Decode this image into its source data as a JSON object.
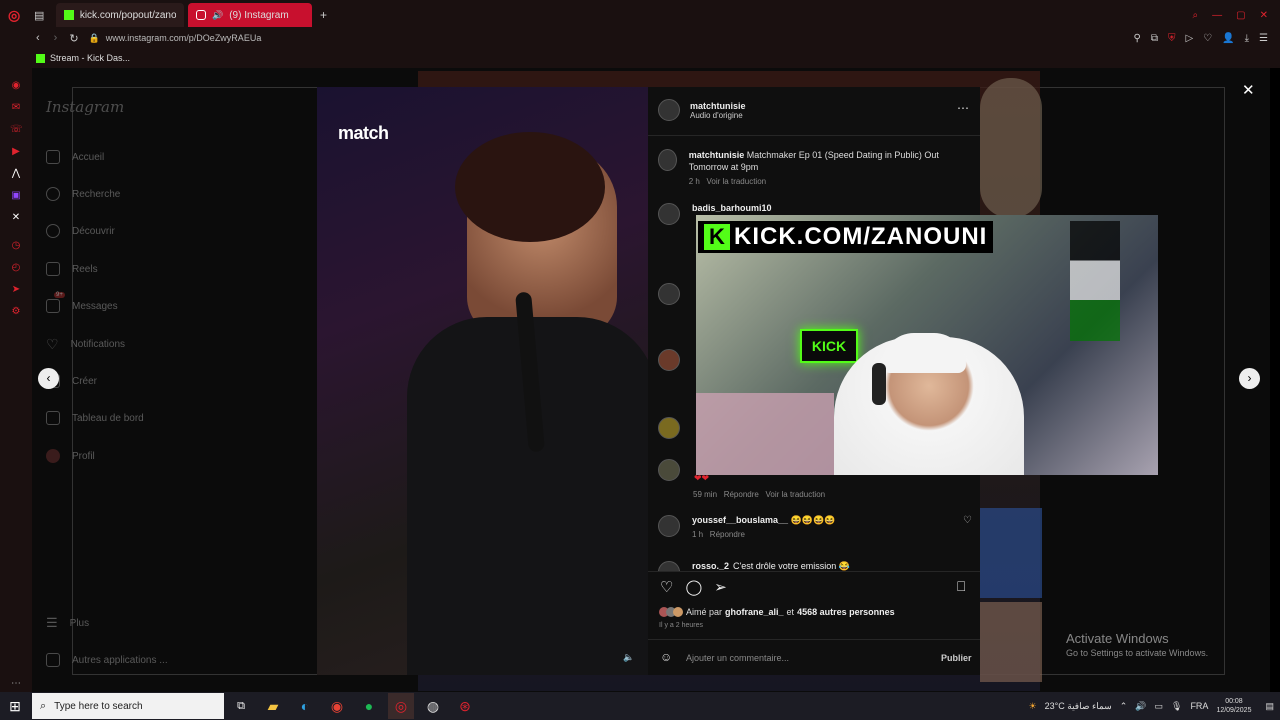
{
  "browser": {
    "tabs": [
      {
        "label": "kick.com/popout/zanouni",
        "favicon": "kick-icon",
        "active": false
      },
      {
        "label": "(9) Instagram",
        "favicon": "instagram-icon",
        "active": true
      }
    ],
    "url": "www.instagram.com/p/DOeZwyRAEUa",
    "bookmark": "Stream - Kick Das..."
  },
  "instagram": {
    "logo": "Instagram",
    "nav": [
      {
        "label": "Accueil",
        "icon": "home-icon"
      },
      {
        "label": "Recherche",
        "icon": "search-icon"
      },
      {
        "label": "Découvrir",
        "icon": "compass-icon"
      },
      {
        "label": "Reels",
        "icon": "reels-icon"
      },
      {
        "label": "Messages",
        "icon": "messages-icon",
        "badge": "9+"
      },
      {
        "label": "Notifications",
        "icon": "heart-icon"
      },
      {
        "label": "Créer",
        "icon": "create-icon"
      },
      {
        "label": "Tableau de bord",
        "icon": "dashboard-icon"
      },
      {
        "label": "Profil",
        "icon": "profile-icon"
      }
    ],
    "bottom_nav": [
      {
        "label": "Plus",
        "icon": "menu-icon"
      },
      {
        "label": "Autres applications ...",
        "icon": "apps-icon"
      }
    ]
  },
  "post": {
    "watermark": "match",
    "author": "matchtunisie",
    "audio": "Audio d'origine",
    "caption_author": "matchtunisie",
    "caption": "Matchmaker Ep 01 (Speed Dating in Public) Out Tomorrow at 9pm",
    "caption_time": "2 h",
    "translate": "Voir la traduction",
    "comments": [
      {
        "user": "badis_barhoumi10",
        "text": "",
        "time": "",
        "actions": ""
      },
      {
        "user": "",
        "text": "❤❤",
        "time": "59 min",
        "reply": "Répondre",
        "translate": "Voir la traduction"
      },
      {
        "user": "youssef__bouslama__",
        "text": "😆😆😆😆",
        "time": "1 h",
        "reply": "Répondre"
      },
      {
        "user": "rosso._2",
        "text": "C'est drôle votre emission 😂"
      }
    ],
    "likes": {
      "prefix": "Aimé par",
      "user": "ghofrane_ali_",
      "middle": "et",
      "count": "4568 autres personnes"
    },
    "posted": "Il y a 2 heures",
    "comment_placeholder": "Ajouter un commentaire...",
    "publish": "Publier"
  },
  "stream_overlay": {
    "banner": "KICK.COM/ZANOUNI",
    "neon": "KICK"
  },
  "windows_watermark": {
    "title": "Activate Windows",
    "subtitle": "Go to Settings to activate Windows."
  },
  "taskbar": {
    "search_placeholder": "Type here to search",
    "weather": "23°C  سماء صافية",
    "lang": "FRA",
    "time": "00:08",
    "date": "12/09/2025"
  }
}
